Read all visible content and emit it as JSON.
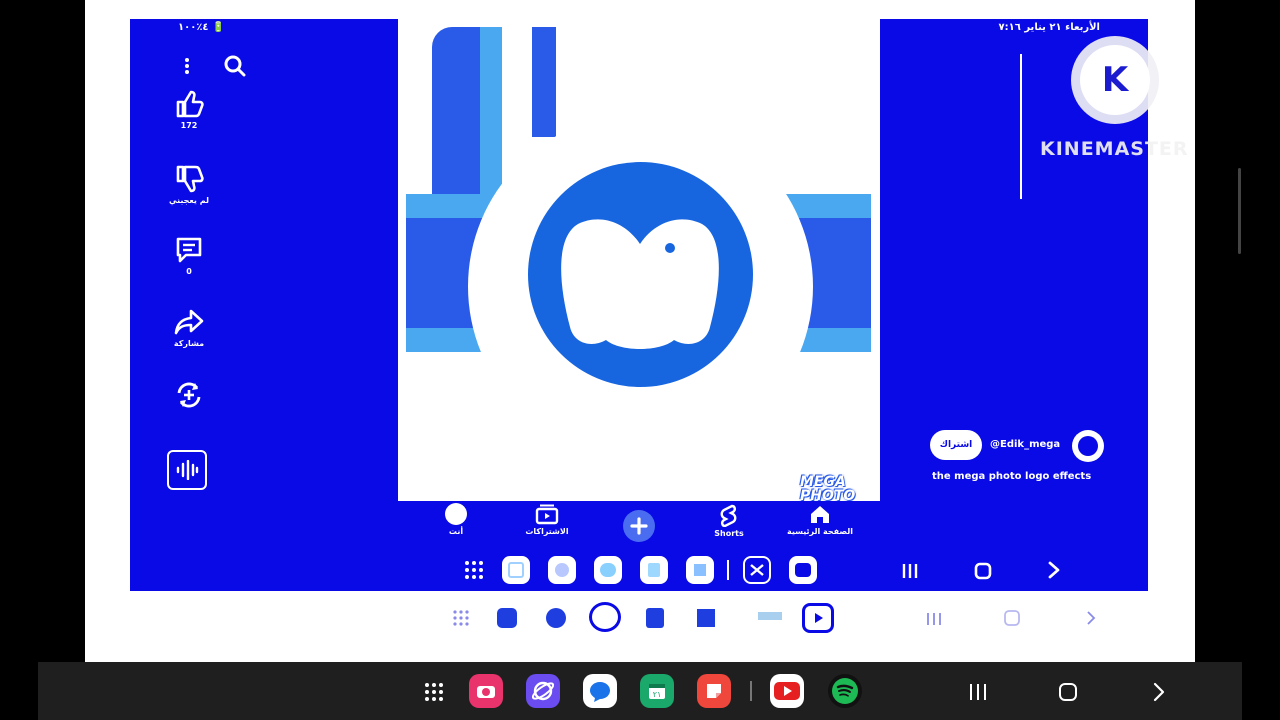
{
  "status_bar": {
    "left": "٤٪١٠٠ 🔋",
    "right": "الأربعاء ٢١ يناير ٧:١٦"
  },
  "side_actions": {
    "like_count": "172",
    "dislike_label": "لم يعجبني",
    "comments_count": "0",
    "share_label": "مشاركة"
  },
  "video": {
    "watermark_line1": "MEGA",
    "watermark_line2": "PHOTO"
  },
  "channel": {
    "handle": "@Edik_mega",
    "subscribe_label": "اشتراك",
    "title": "the mega photo logo effects"
  },
  "bottom_nav": {
    "you": "أنت",
    "subscriptions": "الاشتراكات",
    "shorts": "Shorts",
    "home": "الصفحة الرئيسية"
  },
  "kinemaster": {
    "label": "KINEMASTER",
    "badge_letter": "K"
  },
  "icons": [
    "search-icon",
    "more-icon",
    "like-icon",
    "dislike-icon",
    "comment-icon",
    "share-icon",
    "remix-icon",
    "audio-icon",
    "create-icon",
    "home-icon",
    "shorts-icon",
    "subscriptions-icon",
    "apps-grid-icon",
    "recents-icon",
    "home-circle-icon",
    "back-icon"
  ],
  "colors": {
    "screen_blue": "#0a0ae6",
    "youtube_red": "#e62020",
    "spotify_green": "#1db954"
  }
}
